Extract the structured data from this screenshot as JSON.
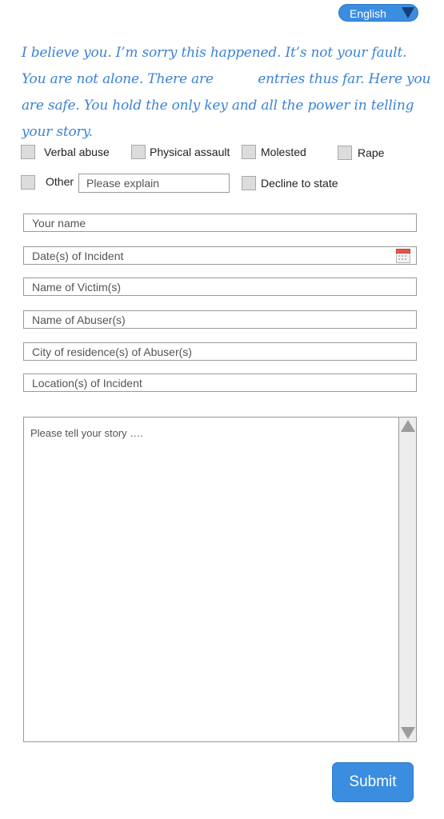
{
  "language": {
    "selected": "English"
  },
  "intro": {
    "part1": "I believe you. I’m sorry this happened. It’s not your fault. You are not alone. There are",
    "count": "",
    "part2": "entries thus far. Here you are safe. You hold the only key and all the power in telling your story."
  },
  "categories": {
    "verbal_abuse": "Verbal abuse",
    "physical_assault": "Physical assault",
    "molested": "Molested",
    "rape": "Rape",
    "other": "Other",
    "other_placeholder": "Please explain",
    "decline": "Decline to state"
  },
  "fields": {
    "your_name": "Your name",
    "dates": "Date(s) of Incident",
    "victims": "Name of Victim(s)",
    "abusers": "Name of Abuser(s)",
    "city": "City of residence(s) of Abuser(s)",
    "location": "Location(s) of Incident"
  },
  "story": {
    "placeholder": "Please tell your story …."
  },
  "submit": {
    "label": "Submit"
  },
  "colors": {
    "accent": "#3b8de0",
    "intro_text": "#3d83d4",
    "arrow": "#173e7a"
  },
  "icons": {
    "language_dropdown": "chevron-down-icon",
    "date_picker": "calendar-icon",
    "scroll_up": "arrow-up-icon",
    "scroll_down": "arrow-down-icon"
  }
}
